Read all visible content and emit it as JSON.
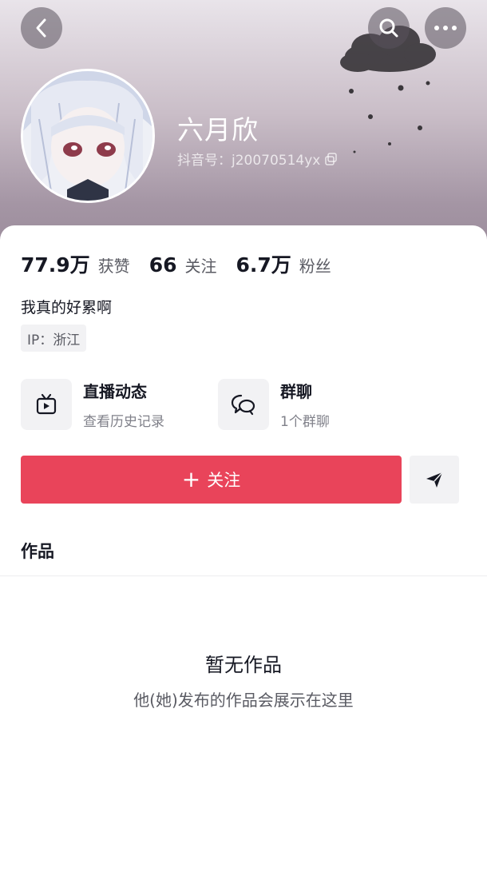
{
  "profile": {
    "nickname": "六月欣",
    "douyin_id": "抖音号：j20070514yx"
  },
  "stats": [
    {
      "value": "77.9万",
      "label": "获赞"
    },
    {
      "value": "66",
      "label": "关注"
    },
    {
      "value": "6.7万",
      "label": "粉丝"
    }
  ],
  "bio": "我真的好累啊",
  "ip_tag": "IP：浙江",
  "features": {
    "live": {
      "title": "直播动态",
      "subtitle": "查看历史记录"
    },
    "group": {
      "title": "群聊",
      "subtitle": "1个群聊"
    }
  },
  "follow_label": "关注",
  "works_tab": "作品",
  "empty": {
    "title": "暂无作品",
    "subtitle": "他(她)发布的作品会展示在这里"
  },
  "colors": {
    "follow_button": "#e9445a",
    "header_top": "#e9e4ea",
    "header_bottom": "#9a8b9a"
  },
  "icons": {
    "back": "chevron-left-icon",
    "search": "search-icon",
    "more": "more-dots-icon",
    "copy": "copy-icon",
    "live": "tv-play-icon",
    "group": "chat-bubbles-icon",
    "share": "send-icon"
  }
}
